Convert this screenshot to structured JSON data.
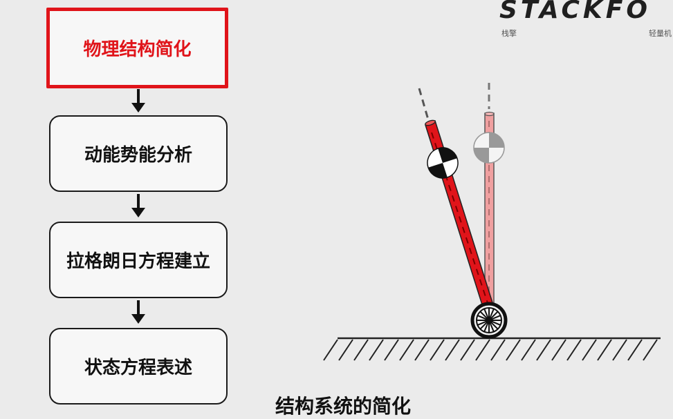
{
  "flowchart": {
    "steps": [
      {
        "label": "物理结构简化",
        "active": true
      },
      {
        "label": "动能势能分析",
        "active": false
      },
      {
        "label": "拉格朗日方程建立",
        "active": false
      },
      {
        "label": "状态方程表述",
        "active": false
      }
    ]
  },
  "brand": {
    "logo": "STACKFO",
    "sub_left": "栈擎",
    "sub_right": "轻量机"
  },
  "caption": {
    "text": "结构系统的简化"
  },
  "colors": {
    "accent": "#e0141a",
    "pole_faded": "#f0a0a0",
    "ink": "#111111"
  }
}
